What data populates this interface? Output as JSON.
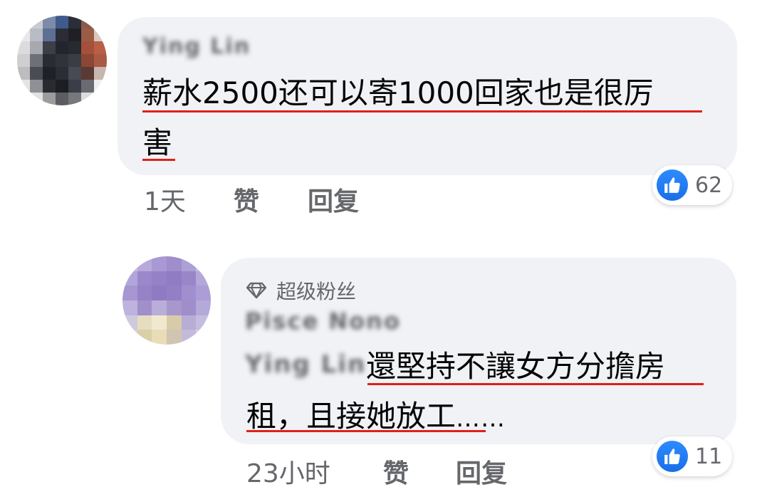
{
  "comments": [
    {
      "author": "Ying Lin",
      "text_line1": "薪水2500还可以寄1000回家也是很厉",
      "text_line2": "害",
      "time": "1天",
      "like_action": "赞",
      "reply_action": "回复",
      "reaction_count": "62",
      "reaction_icon": "thumbs-up-icon"
    },
    {
      "badge": "超级粉丝",
      "badge_icon": "diamond-icon",
      "author": "Pisce Nono",
      "mention": "Ying Lin",
      "text_line1": "還堅持不讓女方分擔房",
      "text_line2": "租，且接她放工",
      "ellipsis": "……",
      "time": "23小时",
      "like_action": "赞",
      "reply_action": "回复",
      "reaction_count": "11",
      "reaction_icon": "thumbs-up-icon"
    }
  ],
  "colors": {
    "bubble": "#f0f2f5",
    "meta_text": "#65676b",
    "body_text": "#050505",
    "underline": "#e0201c",
    "like_blue": "#1a6ee8"
  }
}
